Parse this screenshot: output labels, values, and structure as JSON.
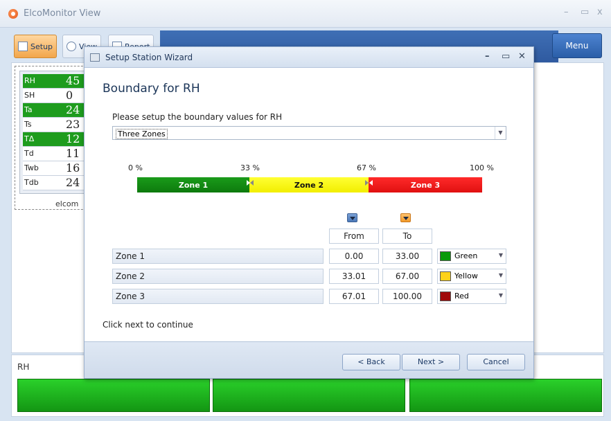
{
  "app": {
    "title": "ElcoMonitor View",
    "win_min": "–",
    "win_max": "▭",
    "win_close": "x"
  },
  "ribbon": {
    "tabs": [
      {
        "label": "Setup"
      },
      {
        "label": "View"
      },
      {
        "label": "Report"
      }
    ],
    "menu_label": "Menu"
  },
  "readings": {
    "rows": [
      {
        "name": "RH",
        "value": "45",
        "highlight": true
      },
      {
        "name": "SH",
        "value": "0",
        "highlight": false
      },
      {
        "name": "Ta",
        "value": "24",
        "highlight": true
      },
      {
        "name": "Ts",
        "value": "23",
        "highlight": false
      },
      {
        "name": "TΔ",
        "value": "12",
        "highlight": true
      },
      {
        "name": "Td",
        "value": "11",
        "highlight": false
      },
      {
        "name": "Twb",
        "value": "16",
        "highlight": false
      },
      {
        "name": "Tdb",
        "value": "24",
        "highlight": false
      }
    ],
    "footer": "elcom"
  },
  "bottom": {
    "label": "RH"
  },
  "dialog": {
    "title": "Setup Station Wizard",
    "heading": "Boundary for RH",
    "instruction": "Please setup the boundary values for RH",
    "zone_mode": "Three Zones",
    "percent_labels": [
      "0 %",
      "33 %",
      "67 %",
      "100 %"
    ],
    "bar": {
      "zone1": "Zone 1",
      "zone2": "Zone 2",
      "zone3": "Zone 3"
    },
    "columns": {
      "from": "From",
      "to": "To"
    },
    "zones": [
      {
        "name": "Zone 1",
        "from": "0.00",
        "to": "33.00",
        "color_name": "Green",
        "color": "#0a9a0a"
      },
      {
        "name": "Zone 2",
        "from": "33.01",
        "to": "67.00",
        "color_name": "Yellow",
        "color": "#ffd21a"
      },
      {
        "name": "Zone 3",
        "from": "67.01",
        "to": "100.00",
        "color_name": "Red",
        "color": "#a00a0a"
      }
    ],
    "footer_text": "Click next to continue",
    "buttons": {
      "back": "< Back",
      "next": "Next >",
      "cancel": "Cancel"
    }
  }
}
